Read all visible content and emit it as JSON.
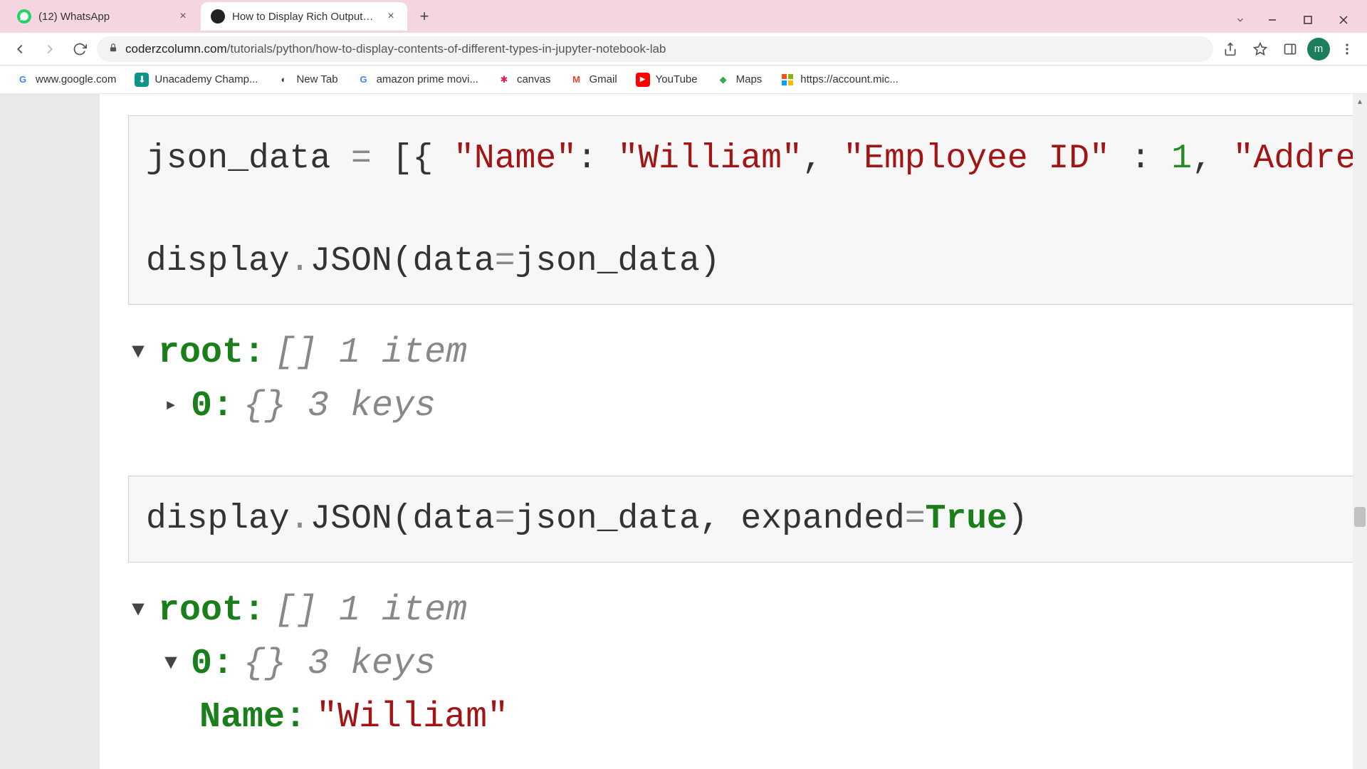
{
  "tabs": [
    {
      "title": "(12) WhatsApp",
      "favicon_bg": "#25d366",
      "favicon_text": "",
      "active": false
    },
    {
      "title": "How to Display Rich Outputs (im",
      "favicon_bg": "#222",
      "favicon_text": "",
      "active": true
    }
  ],
  "url": {
    "domain": "coderzcolumn.com",
    "path": "/tutorials/python/how-to-display-contents-of-different-types-in-jupyter-notebook-lab"
  },
  "profile_letter": "m",
  "bookmarks": [
    {
      "label": "www.google.com",
      "icon": "G",
      "icon_bg": "#fff",
      "icon_color": "#4285f4"
    },
    {
      "label": "Unacademy Champ...",
      "icon": "U",
      "icon_bg": "#0d9488",
      "icon_color": "#fff"
    },
    {
      "label": "New Tab",
      "icon": "◐",
      "icon_bg": "#fff",
      "icon_color": "#333"
    },
    {
      "label": "amazon prime movi...",
      "icon": "G",
      "icon_bg": "#fff",
      "icon_color": "#4285f4"
    },
    {
      "label": "canvas",
      "icon": "✱",
      "icon_bg": "#fff",
      "icon_color": "#e11d48"
    },
    {
      "label": "Gmail",
      "icon": "M",
      "icon_bg": "#fff",
      "icon_color": "#ea4335"
    },
    {
      "label": "YouTube",
      "icon": "▶",
      "icon_bg": "#ff0000",
      "icon_color": "#fff"
    },
    {
      "label": "Maps",
      "icon": "◆",
      "icon_bg": "#fff",
      "icon_color": "#34a853"
    },
    {
      "label": "https://account.mic...",
      "icon": "⊞",
      "icon_bg": "#fff",
      "icon_color": "#00a4ef"
    }
  ],
  "code1": {
    "assign_target": "json_data",
    "op_assign": " = ",
    "bracket_open": "[{ ",
    "key1": "\"Name\"",
    "colon1": ": ",
    "val1": "\"William\"",
    "comma1": ", ",
    "key2": "\"Employee ID\"",
    "colon2": " : ",
    "val2": "1",
    "comma2": ", ",
    "key3": "\"Addres",
    "line2_a": "display",
    "line2_dot": ".",
    "line2_b": "JSON",
    "line2_par": "(data",
    "line2_eq": "=",
    "line2_arg": "json_data",
    "line2_close": ")"
  },
  "output1": {
    "root_label": "root:",
    "root_type": "[]",
    "root_count": "1 item",
    "child_label": "0:",
    "child_type": "{}",
    "child_count": "3 keys"
  },
  "code2": {
    "a": "display",
    "dot": ".",
    "b": "JSON",
    "par": "(data",
    "eq1": "=",
    "arg1": "json_data",
    "comma": ", ",
    "arg2name": "expanded",
    "eq2": "=",
    "true": "True",
    "close": ")"
  },
  "output2": {
    "root_label": "root:",
    "root_type": "[]",
    "root_count": "1 item",
    "child_label": "0:",
    "child_type": "{}",
    "child_count": "3 keys",
    "entry_key": "Name:",
    "entry_val": "\"William\""
  }
}
